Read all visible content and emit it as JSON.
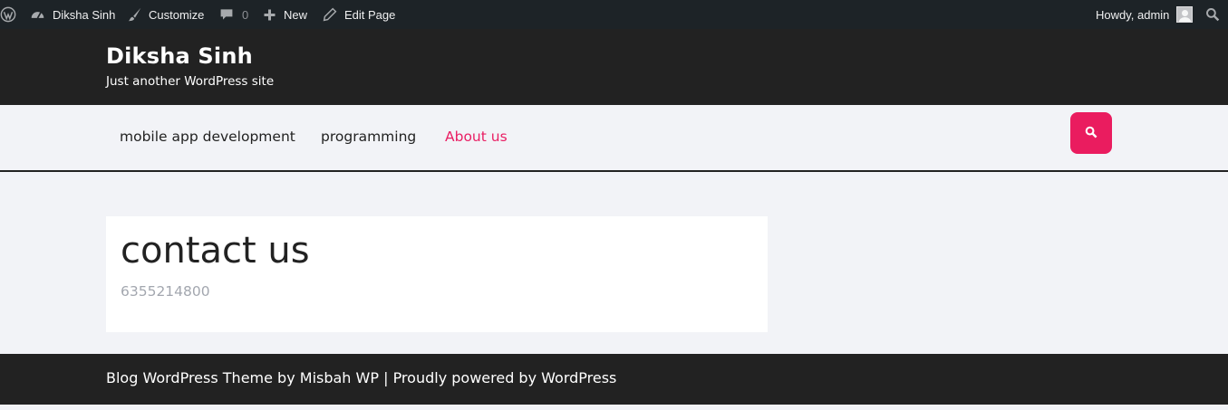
{
  "adminbar": {
    "site_name": "Diksha Sinh",
    "customize": "Customize",
    "comments_count": "0",
    "new": "New",
    "edit_page": "Edit Page",
    "howdy": "Howdy, admin",
    "icons": [
      "wordpress-logo-icon",
      "dashboard-icon",
      "brush-icon",
      "comment-icon",
      "plus-icon",
      "pencil-icon",
      "search-icon"
    ]
  },
  "header": {
    "site_title": "Diksha Sinh",
    "tagline": "Just another WordPress site"
  },
  "nav": {
    "items": [
      {
        "label": "mobile app development",
        "active": false
      },
      {
        "label": "programming",
        "active": false
      },
      {
        "label": "About us",
        "active": true
      }
    ],
    "search_icon": "search-icon"
  },
  "main": {
    "title": "contact us",
    "text": "6355214800"
  },
  "footer": {
    "text": "Blog WordPress Theme by Misbah WP | Proudly powered by WordPress"
  },
  "colors": {
    "admin_bar": "#1d2327",
    "header_bg": "#222222",
    "accent": "#e91e63",
    "page_bg": "#f2f3f7"
  }
}
